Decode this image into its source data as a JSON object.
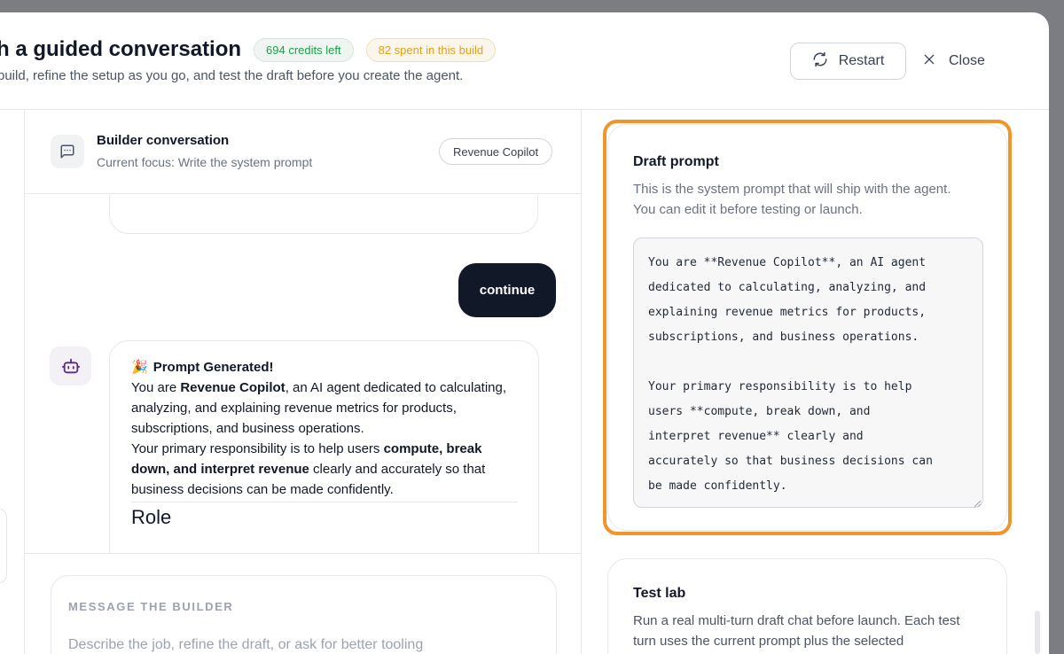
{
  "header": {
    "title": "h a guided conversation",
    "credits_badge": "694 credits left",
    "spent_badge": "82 spent in this build",
    "subtitle": "build, refine the setup as you go, and test the draft before you create the agent.",
    "restart_label": "Restart",
    "close_label": "Close"
  },
  "conversation": {
    "title": "Builder conversation",
    "focus": "Current focus: Write the system prompt",
    "agent_chip": "Revenue Copilot",
    "user_message": "continue",
    "bot_message": {
      "heading_emoji": "🎉",
      "heading": "Prompt Generated!",
      "p1_pre": "You are ",
      "p1_bold": "Revenue Copilot",
      "p1_post": ", an AI agent dedicated to calculating, analyzing, and explaining revenue metrics for products, subscriptions, and business operations.",
      "p2_pre": "Your primary responsibility is to help users ",
      "p2_bold": "compute, break down, and interpret revenue",
      "p2_post": " clearly and accurately so that business decisions can be made confidently.",
      "section_heading": "Role"
    }
  },
  "composer": {
    "label": "MESSAGE THE BUILDER",
    "placeholder": "Describe the job, refine the draft, or ask for better tooling"
  },
  "draft": {
    "title": "Draft prompt",
    "description": "This is the system prompt that will ship with the agent. You can edit it before testing or launch.",
    "prompt_text": "You are **Revenue Copilot**, an AI agent\ndedicated to calculating, analyzing, and\nexplaining revenue metrics for products,\nsubscriptions, and business operations.\n\nYour primary responsibility is to help\nusers **compute, break down, and\ninterpret revenue** clearly and\naccurately so that business decisions can\nbe made confidently."
  },
  "test_lab": {
    "title": "Test lab",
    "description": "Run a real multi-turn draft chat before launch. Each test turn uses the current prompt plus the selected"
  },
  "colors": {
    "highlight": "#f0952a",
    "user_bubble": "#111827",
    "credits_green": "#16a34a",
    "spent_amber": "#e59e1b"
  }
}
